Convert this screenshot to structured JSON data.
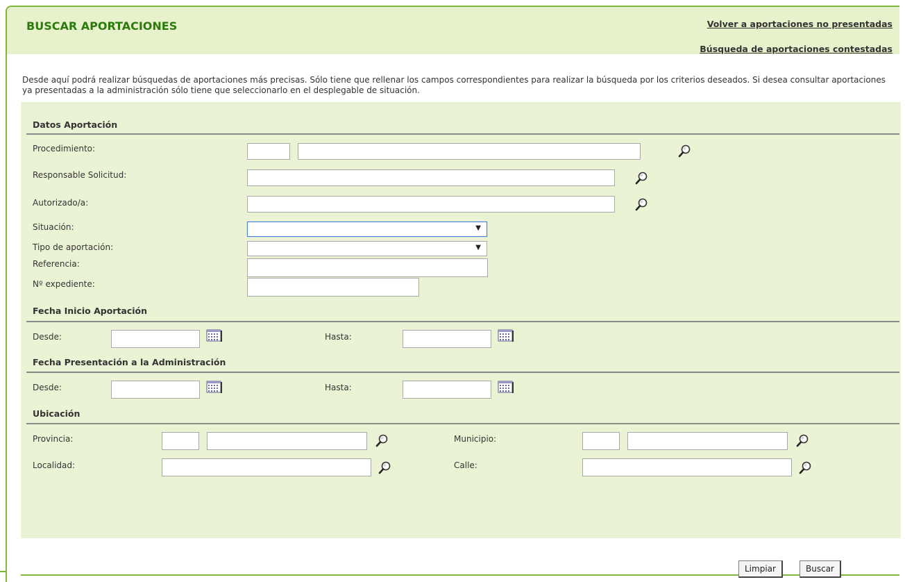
{
  "header": {
    "title": "BUSCAR APORTACIONES",
    "links": [
      "Volver a aportaciones no presentadas",
      "Búsqueda de aportaciones contestadas"
    ]
  },
  "intro": "Desde aquí podrá realizar búsquedas de aportaciones más precisas. Sólo tiene que rellenar los campos correspondientes para realizar la búsqueda por los criterios deseados. Si desea consultar aportaciones ya presentadas a la administración sólo tiene que seleccionarlo en el desplegable de situación.",
  "sections": {
    "datos": "Datos Aportación",
    "fecha_inicio": "Fecha Inicio Aportación",
    "fecha_presentacion": "Fecha Presentación a la Administración",
    "ubicacion": "Ubicación"
  },
  "labels": {
    "procedimiento": "Procedimiento:",
    "responsable": "Responsable Solicitud:",
    "autorizado": "Autorizado/a:",
    "situacion": "Situación:",
    "tipo": "Tipo de aportación:",
    "referencia": "Referencia:",
    "expediente": "Nº expediente:",
    "desde": "Desde:",
    "hasta": "Hasta:",
    "provincia": "Provincia:",
    "municipio": "Municipio:",
    "localidad": "Localidad:",
    "calle": "Calle:"
  },
  "fields": {
    "procedimiento_code": "",
    "procedimiento_name": "",
    "responsable": "",
    "autorizado": "",
    "situacion": "",
    "tipo": "",
    "referencia": "",
    "expediente": "",
    "inicio_desde": "",
    "inicio_hasta": "",
    "pres_desde": "",
    "pres_hasta": "",
    "provincia_code": "",
    "provincia_name": "",
    "municipio_code": "",
    "municipio_name": "",
    "localidad": "",
    "calle": ""
  },
  "buttons": {
    "limpiar": "Limpiar",
    "buscar": "Buscar"
  },
  "icons": {
    "search": "magnifier-icon",
    "calendar": "calendar-icon"
  },
  "colors": {
    "accent": "#7fb53a",
    "title": "#2b7a0b",
    "panel": "#ebf3d5",
    "header": "#e7f2cc"
  }
}
